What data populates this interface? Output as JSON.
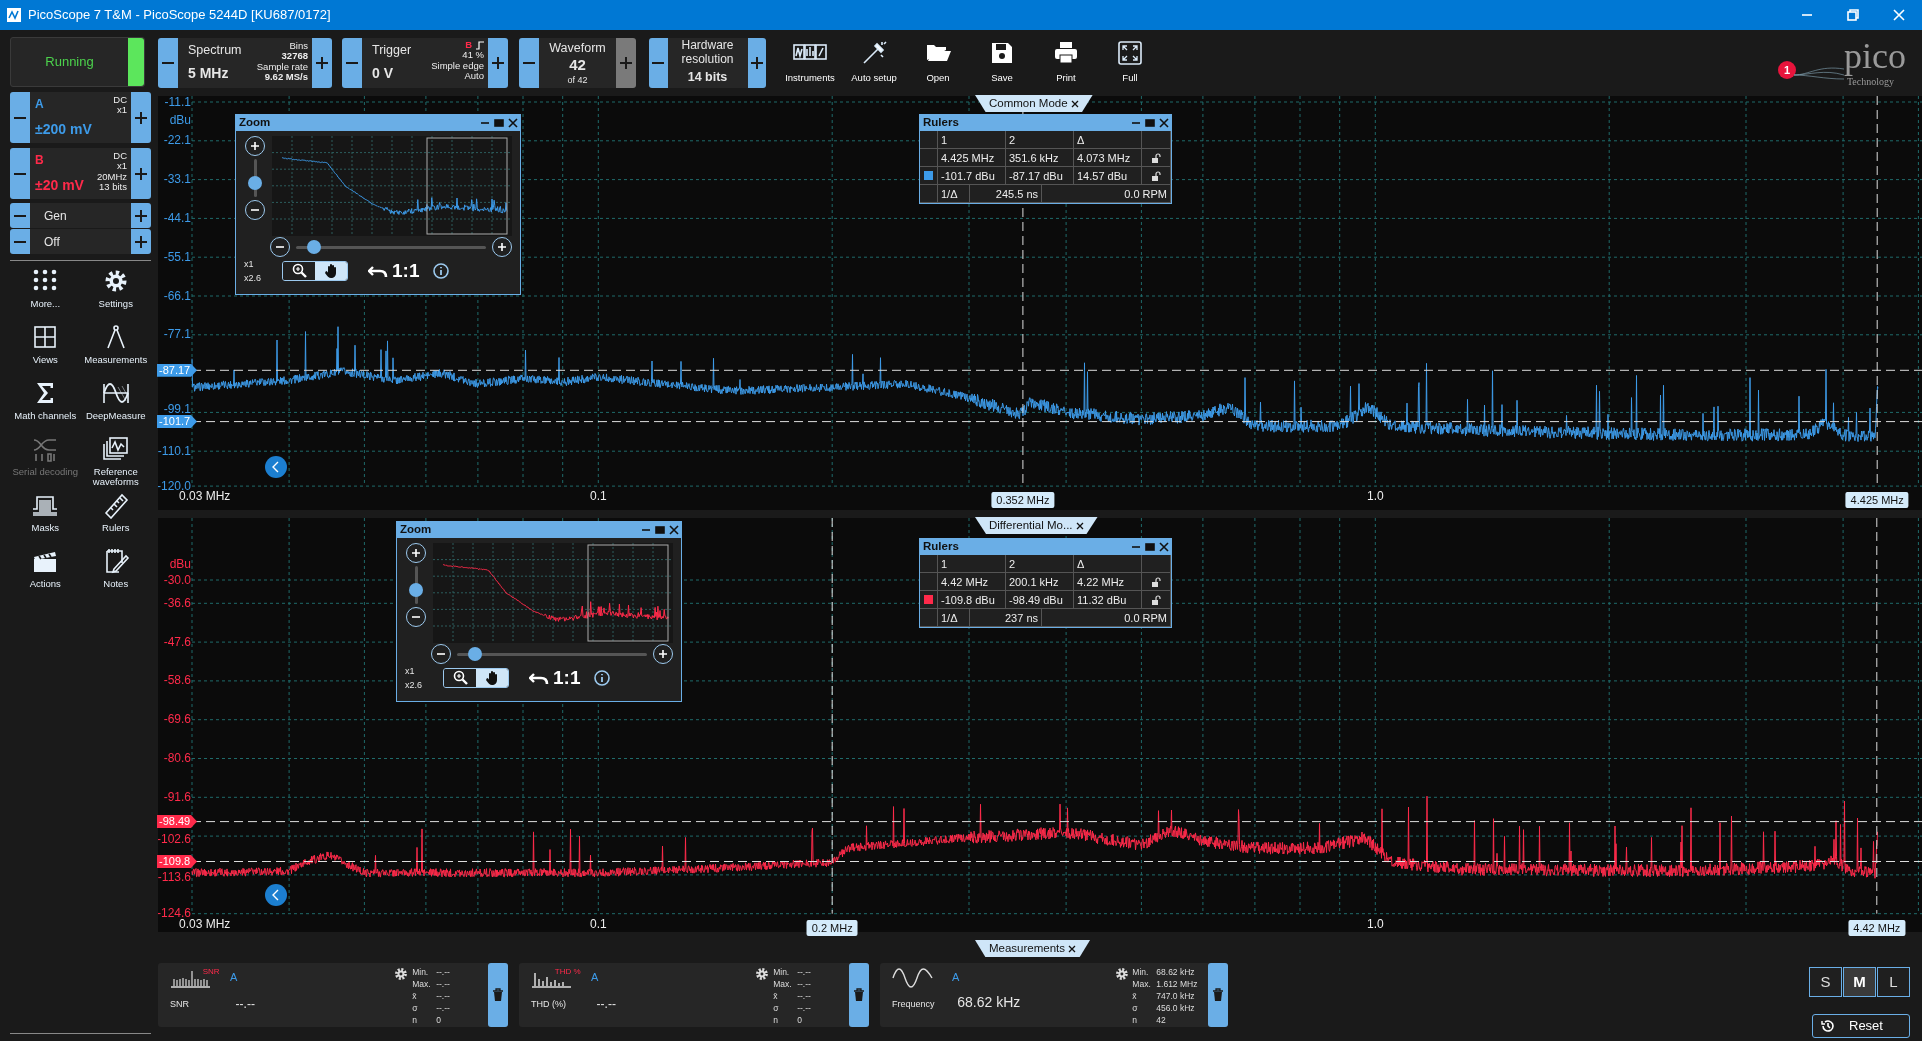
{
  "window": {
    "title": "PicoScope 7 T&M  - PicoScope 5244D [KU687/0172]"
  },
  "run_button": {
    "label": "Running",
    "running": true
  },
  "toolbar": {
    "spectrum": {
      "title": "Spectrum",
      "value": "5 MHz",
      "details": [
        "Bins",
        "32768",
        "Sample rate",
        "9.62 MS/s"
      ]
    },
    "trigger": {
      "title": "Trigger",
      "value": "0 V",
      "source": "B",
      "details": [
        "41 %",
        "Simple edge",
        "Auto"
      ]
    },
    "waveform": {
      "title": "Waveform",
      "value": "42",
      "total": "of 42",
      "next_disabled": true
    },
    "resolution": {
      "title": "Hardware resolution",
      "value": "14 bits"
    },
    "buttons": [
      {
        "kind": "instruments",
        "label": "Instruments"
      },
      {
        "kind": "auto",
        "label": "Auto setup"
      },
      {
        "kind": "open",
        "label": "Open"
      },
      {
        "kind": "save",
        "label": "Save"
      },
      {
        "kind": "print",
        "label": "Print"
      },
      {
        "kind": "full",
        "label": "Full"
      }
    ]
  },
  "notifications": {
    "count": "1"
  },
  "logo": {
    "name": "pico",
    "tagline": "Technology"
  },
  "channels": [
    {
      "name": "A",
      "range": "±200 mV",
      "details": [
        "DC",
        "x1"
      ],
      "color": "#3d9be9"
    },
    {
      "name": "B",
      "range": "±20 mV",
      "details": [
        "DC",
        "x1",
        "20MHz",
        "13 bits"
      ],
      "color": "#ff2a4a"
    }
  ],
  "generator": [
    "Gen",
    "Off"
  ],
  "tools": [
    {
      "kind": "more",
      "label": "More...",
      "disabled": false
    },
    {
      "kind": "settings",
      "label": "Settings",
      "disabled": false
    },
    {
      "kind": "views",
      "label": "Views",
      "disabled": false
    },
    {
      "kind": "measurements",
      "label": "Measurements",
      "disabled": false
    },
    {
      "kind": "math",
      "label": "Math channels",
      "disabled": false
    },
    {
      "kind": "deep",
      "label": "DeepMeasure",
      "disabled": false
    },
    {
      "kind": "serial",
      "label": "Serial decoding",
      "disabled": true
    },
    {
      "kind": "reference",
      "label": "Reference waveforms",
      "disabled": false
    },
    {
      "kind": "masks",
      "label": "Masks",
      "disabled": false
    },
    {
      "kind": "rulers",
      "label": "Rulers",
      "disabled": false
    },
    {
      "kind": "actions",
      "label": "Actions",
      "disabled": false
    },
    {
      "kind": "notes",
      "label": "Notes",
      "disabled": false
    }
  ],
  "views": [
    {
      "title": "Common Mode",
      "color": "#3d9be9",
      "y_unit": "dBu",
      "y_ticks": [
        "-11.1",
        "-22.1",
        "-33.1",
        "-44.1",
        "-55.1",
        "-66.1",
        "-77.1",
        "-99.1",
        "-110.1",
        "-120.0"
      ],
      "x_ticks": [
        "0.03 MHz",
        "0.1",
        "1.0"
      ],
      "h_rulers": [
        "-87.17",
        "-101.7"
      ],
      "v_rulers": [
        "0.352 MHz",
        "4.425 MHz"
      ],
      "zoom": {
        "title": "Zoom",
        "scales": [
          "x1",
          "x2.6"
        ],
        "reset": "1:1",
        "zoom_slider": {
          "level": 0.3
        },
        "pan_slider": {
          "level": 0.06
        },
        "tools": [
          {
            "kind": "zoom",
            "selected": false
          },
          {
            "kind": "pan",
            "selected": true
          }
        ]
      },
      "rulers": {
        "title": "Rulers",
        "headers": [
          "1",
          "2",
          "Δ"
        ],
        "rows": [
          [
            "4.425 MHz",
            "351.6 kHz",
            "4.073 MHz"
          ],
          [
            "-101.7 dBu",
            "-87.17 dBu",
            "14.57 dBu"
          ]
        ],
        "footer": [
          "1/Δ",
          "245.5 ns",
          "0.0 RPM"
        ]
      }
    },
    {
      "title": "Differential Mo...",
      "color": "#ff2a4a",
      "y_unit": "dBu",
      "y_ticks": [
        "-30.0",
        "-36.6",
        "-47.6",
        "-58.6",
        "-69.6",
        "-80.6",
        "-91.6",
        "-102.6",
        "-113.6",
        "-124.6"
      ],
      "x_ticks": [
        "0.03 MHz",
        "0.1",
        "1.0"
      ],
      "h_rulers": [
        "-98.49",
        "-109.8"
      ],
      "v_rulers": [
        "0.2 MHz",
        "4.42 MHz"
      ],
      "zoom": {
        "title": "Zoom",
        "scales": [
          "x1",
          "x2.6"
        ],
        "reset": "1:1",
        "zoom_slider": {
          "level": 0.3
        },
        "pan_slider": {
          "level": 0.06
        },
        "tools": [
          {
            "kind": "zoom",
            "selected": false
          },
          {
            "kind": "pan",
            "selected": true
          }
        ]
      },
      "rulers": {
        "title": "Rulers",
        "headers": [
          "1",
          "2",
          "Δ"
        ],
        "rows": [
          [
            "4.42 MHz",
            "200.1 kHz",
            "4.22 MHz"
          ],
          [
            "-109.8 dBu",
            "-98.49 dBu",
            "11.32 dBu"
          ]
        ],
        "footer": [
          "1/Δ",
          "237 ns",
          "0.0 RPM"
        ]
      }
    }
  ],
  "measurements": {
    "title": "Measurements",
    "cards": [
      {
        "kind": "snr",
        "icon_label": "SNR",
        "channel": "A",
        "name": "SNR",
        "value": "--.--",
        "stats": [
          [
            "Min.",
            "--.--"
          ],
          [
            "Max.",
            "--.--"
          ],
          [
            "x̄",
            "--.--"
          ],
          [
            "σ",
            "--.--"
          ],
          [
            "n",
            "0"
          ]
        ]
      },
      {
        "kind": "thd",
        "icon_label": "THD %",
        "channel": "A",
        "name": "THD (%)",
        "value": "--.--",
        "stats": [
          [
            "Min.",
            "--.--"
          ],
          [
            "Max.",
            "--.--"
          ],
          [
            "x̄",
            "--.--"
          ],
          [
            "σ",
            "--.--"
          ],
          [
            "n",
            "0"
          ]
        ]
      },
      {
        "kind": "frequency",
        "channel": "A",
        "name": "Frequency",
        "value": "68.62 kHz",
        "stats": [
          [
            "Min.",
            "68.62 kHz"
          ],
          [
            "Max.",
            "1.612 MHz"
          ],
          [
            "x̄",
            "747.0 kHz"
          ],
          [
            "σ",
            "456.0 kHz"
          ],
          [
            "n",
            "42"
          ]
        ]
      }
    ]
  },
  "sizes": [
    {
      "label": "S",
      "selected": false
    },
    {
      "label": "M",
      "selected": true
    },
    {
      "label": "L",
      "selected": false
    }
  ],
  "reset_button": {
    "label": "Reset"
  }
}
